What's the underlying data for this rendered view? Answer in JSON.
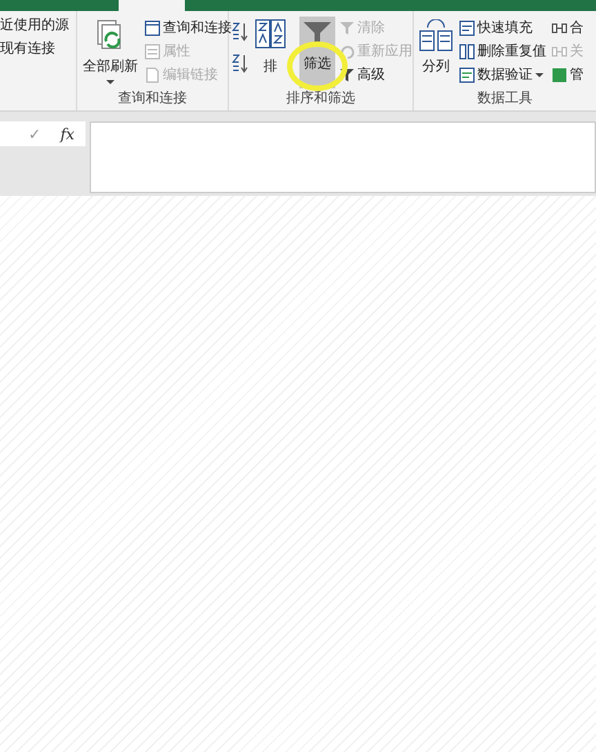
{
  "connections": {
    "items": [
      {
        "label": "近使用的源"
      },
      {
        "label": "现有连接"
      }
    ]
  },
  "queries": {
    "label": "查询和连接",
    "refresh_all": "全部刷新",
    "items": [
      {
        "label": "查询和连接",
        "disabled": false
      },
      {
        "label": "属性",
        "disabled": true
      },
      {
        "label": "编辑链接",
        "disabled": true
      }
    ]
  },
  "sort_filter": {
    "label": "排序和筛选",
    "sort": "排",
    "filter": {
      "label": "筛选",
      "selected": true
    },
    "items": [
      {
        "label": "清除",
        "disabled": true
      },
      {
        "label": "重新应用",
        "disabled": true
      },
      {
        "label": "高级",
        "disabled": false
      }
    ]
  },
  "data_tools": {
    "label": "数据工具",
    "text_to_columns": "分列",
    "items": [
      {
        "label": "快速填充",
        "disabled": false
      },
      {
        "label": "删除重复值",
        "disabled": false
      },
      {
        "label": "数据验证",
        "disabled": false
      }
    ],
    "more": [
      {
        "label": "合",
        "disabled": false
      },
      {
        "label": "关",
        "disabled": true
      },
      {
        "label": "管",
        "disabled": false
      }
    ]
  },
  "formula_bar": {
    "enter": "✓",
    "fx": "fx"
  }
}
